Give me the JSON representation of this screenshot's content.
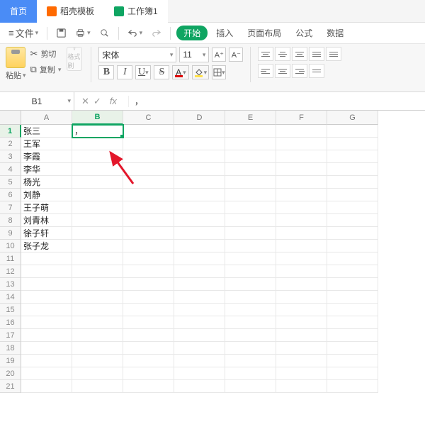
{
  "tabs": {
    "home": "首页",
    "template": "稻壳模板",
    "workbook": "工作簿1"
  },
  "file": {
    "menu": "文件"
  },
  "ribbonTabs": {
    "start": "开始",
    "insert": "插入",
    "layout": "页面布局",
    "formula": "公式",
    "data": "数据"
  },
  "clipboard": {
    "paste": "粘贴",
    "cut": "剪切",
    "copy": "复制",
    "brush": "格式刷"
  },
  "font": {
    "name": "宋体",
    "size": "11",
    "increase": "A⁺",
    "decrease": "A⁻"
  },
  "namebox": "B1",
  "formula": "，",
  "columns": [
    "A",
    "B",
    "C",
    "D",
    "E",
    "F",
    "G"
  ],
  "rows": 21,
  "activeRow": 1,
  "activeCol": "B",
  "cell_data": {
    "A1": "张三",
    "A2": "王军",
    "A3": "李霞",
    "A4": "李华",
    "A5": "杨光",
    "A6": "刘静",
    "A7": "王子萌",
    "A8": "刘青林",
    "A9": "徐子轩",
    "A10": "张子龙",
    "B1": "，"
  }
}
